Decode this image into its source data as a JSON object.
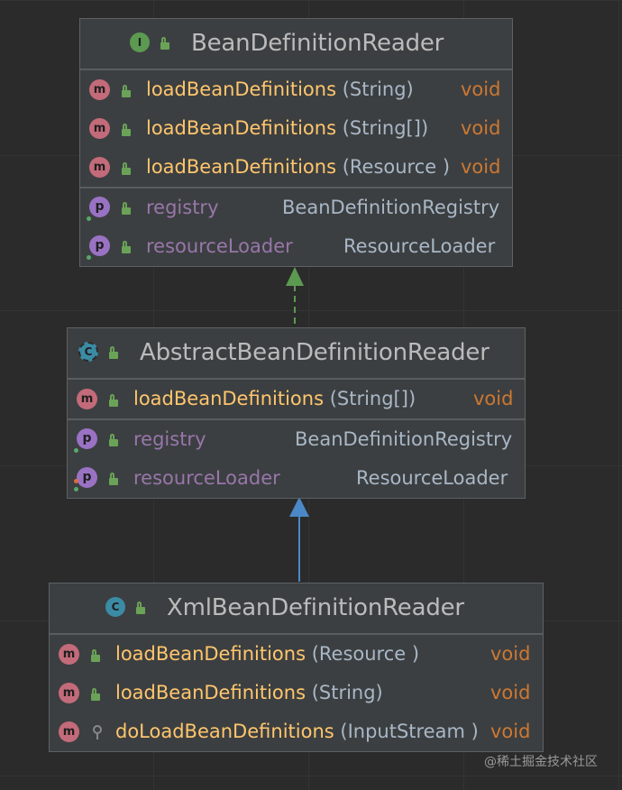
{
  "colors": {
    "background": "#2b2b2b",
    "box": "#3c3f41",
    "method_icon": "#c36b7a",
    "property_icon": "#9a72c4",
    "interface_icon": "#5c9a52",
    "class_icon": "#3b8ba5",
    "method_name": "#ffc66d",
    "property_name": "#9876aa",
    "return_type": "#cc7832",
    "realization_arrow": "#5c9a52",
    "generalization_arrow": "#4a88c7"
  },
  "diagram": {
    "classes": [
      {
        "name": "BeanDefinitionReader",
        "kind_letter": "I",
        "kind_icon": "interface-icon",
        "methods": [
          {
            "name": "loadBeanDefinitions",
            "params": " (String)",
            "type": "void"
          },
          {
            "name": "loadBeanDefinitions",
            "params": " (String[])",
            "type": "void"
          },
          {
            "name": "loadBeanDefinitions",
            "params": " (Resource )",
            "type": "void"
          }
        ],
        "properties": [
          {
            "name": "registry",
            "type": "BeanDefinitionRegistry"
          },
          {
            "name": "resourceLoader",
            "type": "ResourceLoader"
          }
        ]
      },
      {
        "name": "AbstractBeanDefinitionReader",
        "kind_letter": "C",
        "kind_icon": "abstract-class-icon",
        "methods": [
          {
            "name": "loadBeanDefinitions",
            "params": " (String[])",
            "type": "void"
          }
        ],
        "properties": [
          {
            "name": "registry",
            "type": "BeanDefinitionRegistry"
          },
          {
            "name": "resourceLoader",
            "type": "ResourceLoader"
          }
        ]
      },
      {
        "name": "XmlBeanDefinitionReader",
        "kind_letter": "C",
        "kind_icon": "class-icon",
        "methods": [
          {
            "name": "loadBeanDefinitions",
            "params": " (Resource )",
            "type": "void"
          },
          {
            "name": "loadBeanDefinitions",
            "params": " (String)",
            "type": "void"
          },
          {
            "name": "doLoadBeanDefinitions",
            "params": " (InputStream )",
            "type": "void"
          }
        ]
      }
    ],
    "relations": [
      {
        "from": "AbstractBeanDefinitionReader",
        "to": "BeanDefinitionReader",
        "kind": "realization"
      },
      {
        "from": "XmlBeanDefinitionReader",
        "to": "AbstractBeanDefinitionReader",
        "kind": "generalization"
      }
    ],
    "icon_letters": {
      "method": "m",
      "property": "p"
    }
  },
  "watermark": "@稀土掘金技术社区"
}
